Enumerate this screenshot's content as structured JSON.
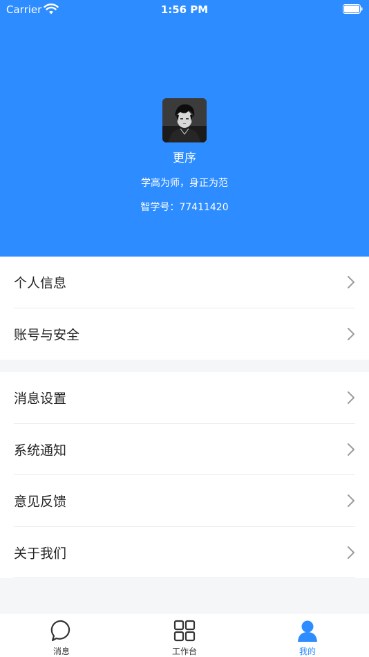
{
  "status_bar": {
    "carrier": "Carrier",
    "time": "1:56 PM"
  },
  "profile": {
    "name": "更序",
    "motto": "学高为师，身正为范",
    "id_label": "智学号：",
    "id_value": "77411420"
  },
  "menu_group_1": [
    {
      "label": "个人信息"
    },
    {
      "label": "账号与安全"
    }
  ],
  "menu_group_2": [
    {
      "label": "消息设置"
    },
    {
      "label": "系统通知"
    },
    {
      "label": "意见反馈"
    },
    {
      "label": "关于我们"
    }
  ],
  "tabbar": {
    "tabs": [
      {
        "label": "消息",
        "icon": "chat-bubble-icon"
      },
      {
        "label": "工作台",
        "icon": "grid-icon"
      },
      {
        "label": "我的",
        "icon": "user-icon"
      }
    ],
    "active": "我的"
  },
  "colors": {
    "accent": "#2d8cff",
    "background": "#f5f6f7"
  }
}
